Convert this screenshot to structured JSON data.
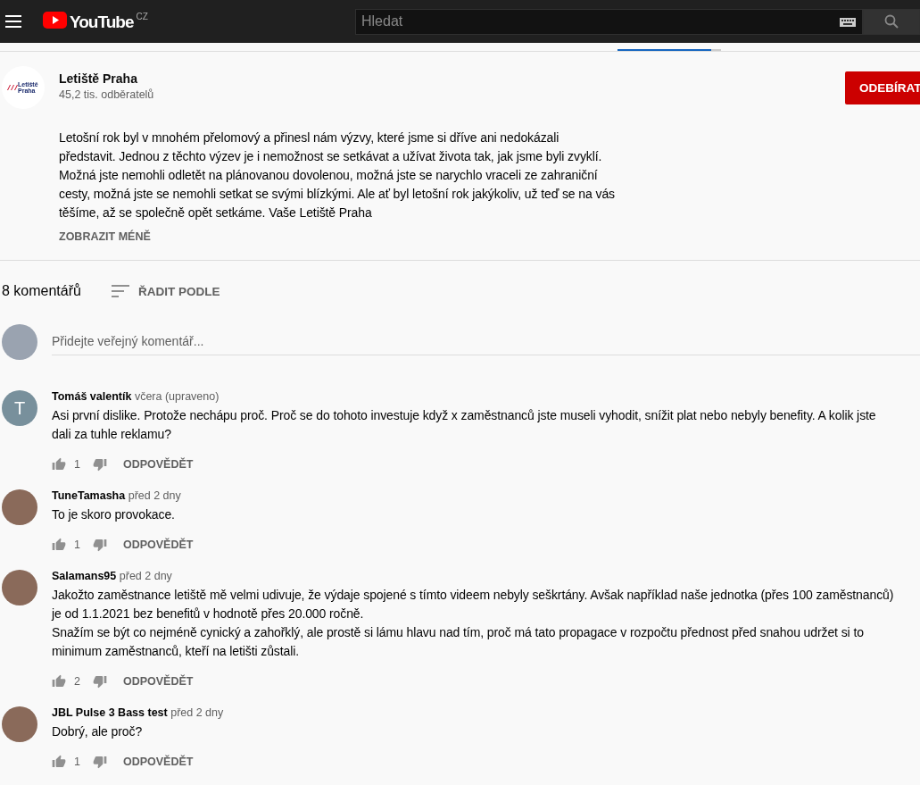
{
  "header": {
    "logo_text": "YouTube",
    "country": "CZ",
    "search": {
      "placeholder": "Hledat"
    }
  },
  "channel": {
    "logo_text": "Letiště Praha",
    "name": "Letiště Praha",
    "subscribers": "45,2 tis. odběratelů",
    "subscribe_label": "ODEBÍRAT"
  },
  "description": "Letošní rok byl v mnohém přelomový a přinesl nám výzvy, které jsme si dříve ani nedokázali představit. Jednou z těchto výzev je i nemožnost se setkávat a užívat života tak, jak jsme byli zvyklí. Možná jste nemohli odletět na plánovanou dovolenou, možná jste se narychlo vraceli ze zahraniční cesty, možná jste se nemohli setkat se svými blízkými. Ale ať byl letošní rok jakýkoliv, už teď se na vás těšíme, až se společně opět setkáme. Vaše Letiště Praha",
  "show_less": "ZOBRAZIT MÉNĚ",
  "comments_count": "8 komentářů",
  "sort_label": "ŘADIT PODLE",
  "comment_input": {
    "placeholder": "Přidejte veřejný komentář..."
  },
  "comments": [
    {
      "author": "Tomáš valentík",
      "time": "včera (upraveno)",
      "avatar": {
        "kind": "letter",
        "letter": "T"
      },
      "text": "Asi první dislike. Protože nechápu proč. Proč se do tohoto investuje když x zaměstnanců jste museli vyhodit, snížit plat nebo nebyly benefity. A kolik jste dali za tuhle reklamu?",
      "likes": "1",
      "reply_label": "ODPOVĚDĚT"
    },
    {
      "author": "TuneTamasha",
      "time": "před 2 dny",
      "avatar": {
        "kind": "photo"
      },
      "text": "To je skoro provokace.",
      "likes": "1",
      "reply_label": "ODPOVĚDĚT"
    },
    {
      "author": "Salamans95",
      "time": "před 2 dny",
      "avatar": {
        "kind": "photo"
      },
      "text": "Jakožto zaměstnance letiště mě velmi udivuje, že výdaje spojené s tímto videem nebyly seškrtány. Avšak například naše jednotka (přes 100 zaměstnanců) je od 1.1.2021 bez benefitů v hodnotě  přes 20.000 ročně.\nSnažím se být co nejméně cynický a zahořklý, ale prostě si lámu hlavu nad tím, proč má tato propagace v rozpočtu přednost před snahou udržet si to minimum zaměstnanců, kteří na letišti zůstali.",
      "likes": "2",
      "reply_label": "ODPOVĚDĚT"
    },
    {
      "author": "JBL Pulse 3 Bass test",
      "time": "před 2 dny",
      "avatar": {
        "kind": "photo"
      },
      "text": "Dobrý, ale proč?",
      "likes": "1",
      "reply_label": "ODPOVĚDĚT"
    }
  ]
}
